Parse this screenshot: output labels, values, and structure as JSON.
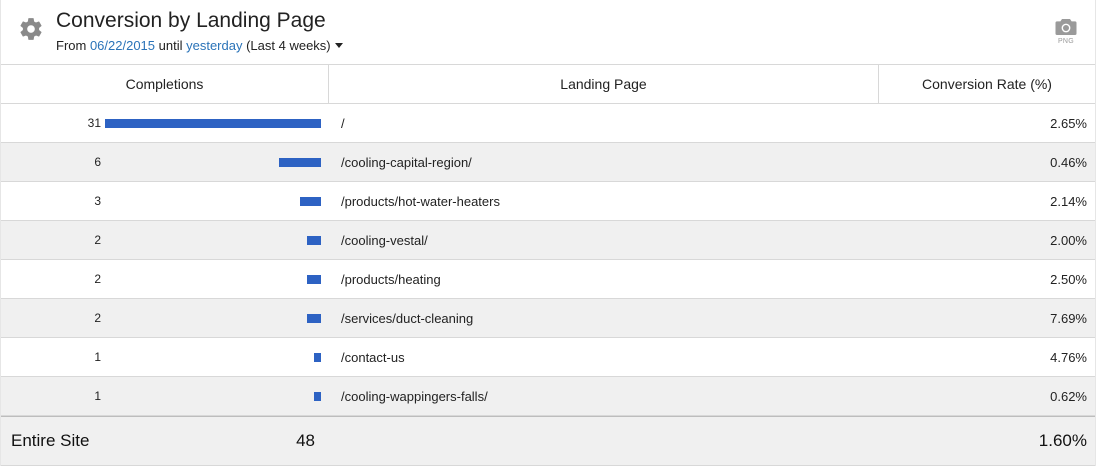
{
  "header": {
    "title": "Conversion by Landing Page",
    "from_prefix": "From ",
    "start_date": "06/22/2015",
    "until_text": " until ",
    "end_date": "yesterday",
    "range_label": " (Last 4 weeks)",
    "settings_icon": "gear-icon",
    "export_icon": "camera-icon",
    "export_label": "PNG"
  },
  "table": {
    "columns": [
      "Completions",
      "Landing Page",
      "Conversion Rate (%)"
    ],
    "max_completions": 31,
    "bar_color": "#2d62c3",
    "rows": [
      {
        "completions": "31",
        "page": "/",
        "rate": "2.65%"
      },
      {
        "completions": "6",
        "page": "/cooling-capital-region/",
        "rate": "0.46%"
      },
      {
        "completions": "3",
        "page": "/products/hot-water-heaters",
        "rate": "2.14%"
      },
      {
        "completions": "2",
        "page": "/cooling-vestal/",
        "rate": "2.00%"
      },
      {
        "completions": "2",
        "page": "/products/heating",
        "rate": "2.50%"
      },
      {
        "completions": "2",
        "page": "/services/duct-cleaning",
        "rate": "7.69%"
      },
      {
        "completions": "1",
        "page": "/contact-us",
        "rate": "4.76%"
      },
      {
        "completions": "1",
        "page": "/cooling-wappingers-falls/",
        "rate": "0.62%"
      }
    ],
    "footer": {
      "label": "Entire Site",
      "total": "48",
      "rate": "1.60%"
    }
  }
}
